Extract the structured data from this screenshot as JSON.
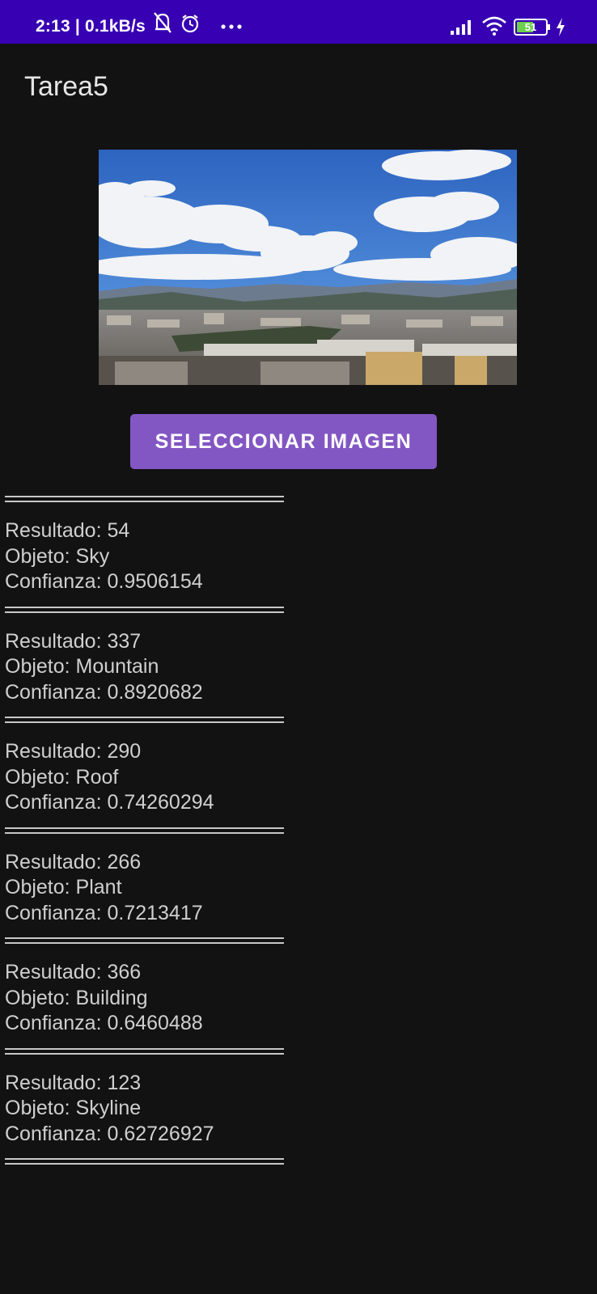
{
  "status_bar": {
    "time": "2:13 | 0.1kB/s",
    "battery": "51",
    "icons": [
      "mute-icon",
      "alarm-icon",
      "more-dots-icon",
      "signal-icon",
      "wifi-icon",
      "battery-icon",
      "charging-icon"
    ]
  },
  "app": {
    "title": "Tarea5"
  },
  "image": {
    "description_icon": "cityscape-photo"
  },
  "button": {
    "label": "SELECCIONAR IMAGEN"
  },
  "results": [
    {
      "resultado": "Resultado: 54",
      "objeto": "Objeto: Sky",
      "confianza": "Confianza: 0.9506154"
    },
    {
      "resultado": "Resultado: 337",
      "objeto": "Objeto: Mountain",
      "confianza": "Confianza: 0.8920682"
    },
    {
      "resultado": "Resultado: 290",
      "objeto": "Objeto: Roof",
      "confianza": "Confianza: 0.74260294"
    },
    {
      "resultado": "Resultado: 266",
      "objeto": "Objeto: Plant",
      "confianza": "Confianza: 0.7213417"
    },
    {
      "resultado": "Resultado: 366",
      "objeto": "Objeto: Building",
      "confianza": "Confianza: 0.6460488"
    },
    {
      "resultado": "Resultado: 123",
      "objeto": "Objeto: Skyline",
      "confianza": "Confianza: 0.62726927"
    }
  ],
  "colors": {
    "status_bar": "#3700b3",
    "background": "#121212",
    "button": "#8357c3",
    "text": "#cfcfcf"
  }
}
